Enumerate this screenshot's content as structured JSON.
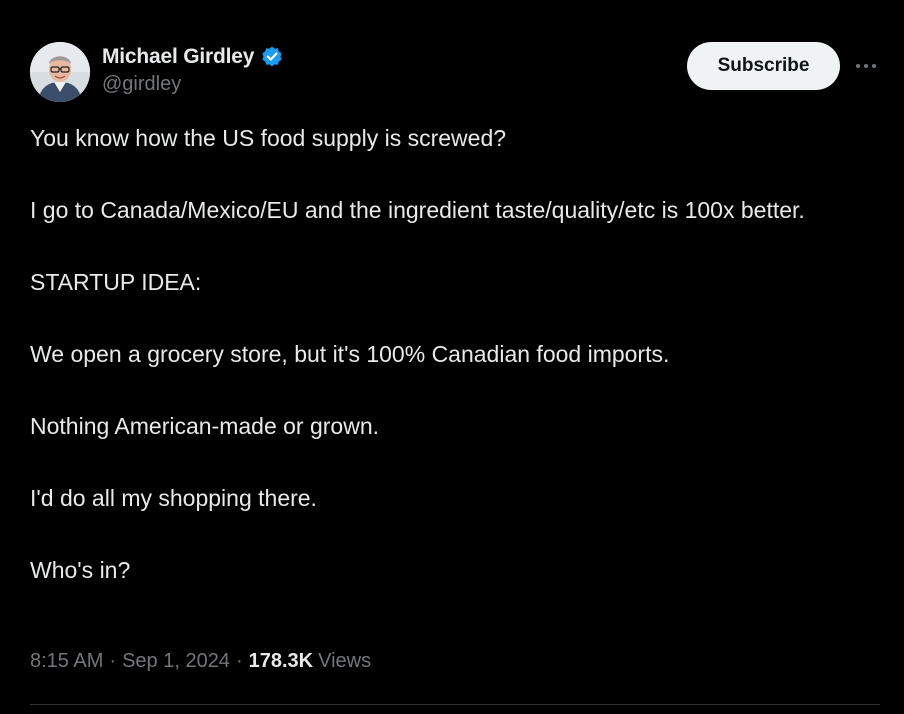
{
  "author": {
    "display_name": "Michael Girdley",
    "handle": "@girdley",
    "verified": true,
    "verified_color": "#1d9bf0",
    "avatar_icon": "profile-photo"
  },
  "actions": {
    "subscribe_label": "Subscribe",
    "more_icon": "more-options-icon"
  },
  "tweet": {
    "paragraphs": [
      "You know how the US food supply is screwed?",
      "I go to Canada/Mexico/EU and the ingredient taste/quality/etc is 100x better.",
      "STARTUP IDEA:",
      "We open a grocery store, but it's 100% Canadian food imports.",
      "Nothing American-made or grown.",
      "I'd do all my shopping there.",
      "Who's in?"
    ]
  },
  "meta": {
    "time": "8:15 AM",
    "separator": "·",
    "date": "Sep 1, 2024",
    "views_count": "178.3K",
    "views_label": "Views"
  },
  "colors": {
    "background": "#000000",
    "text_primary": "#e7e9ea",
    "text_secondary": "#71767b",
    "button_bg": "#eff3f4",
    "button_text": "#0f1419",
    "divider": "#2f3336"
  }
}
